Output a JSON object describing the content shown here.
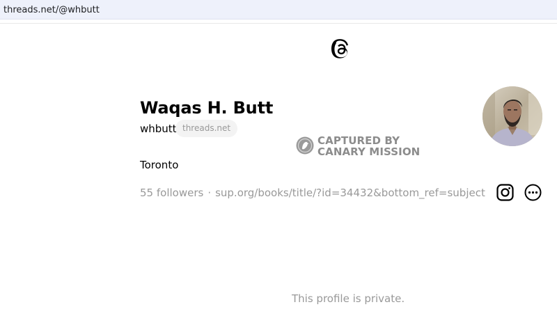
{
  "browser": {
    "url": "threads.net/@whbutt"
  },
  "header": {
    "logo_icon": "threads-logo-icon"
  },
  "profile": {
    "display_name": "Waqas H. Butt",
    "username": "whbutt",
    "domain_badge": "threads.net",
    "location": "Toronto",
    "followers_label": "55 followers",
    "separator": "·",
    "link": "sup.org/books/title/?id=34432&bottom_ref=subject",
    "avatar_icon": "profile-photo"
  },
  "watermark": {
    "line1": "CAPTURED BY",
    "line2": "CANARY MISSION",
    "badge_icon": "canary-mission-badge-icon"
  },
  "actions": {
    "instagram_icon": "instagram-icon",
    "more_icon": "more-options-icon"
  },
  "feed": {
    "private_message": "This profile is private."
  }
}
